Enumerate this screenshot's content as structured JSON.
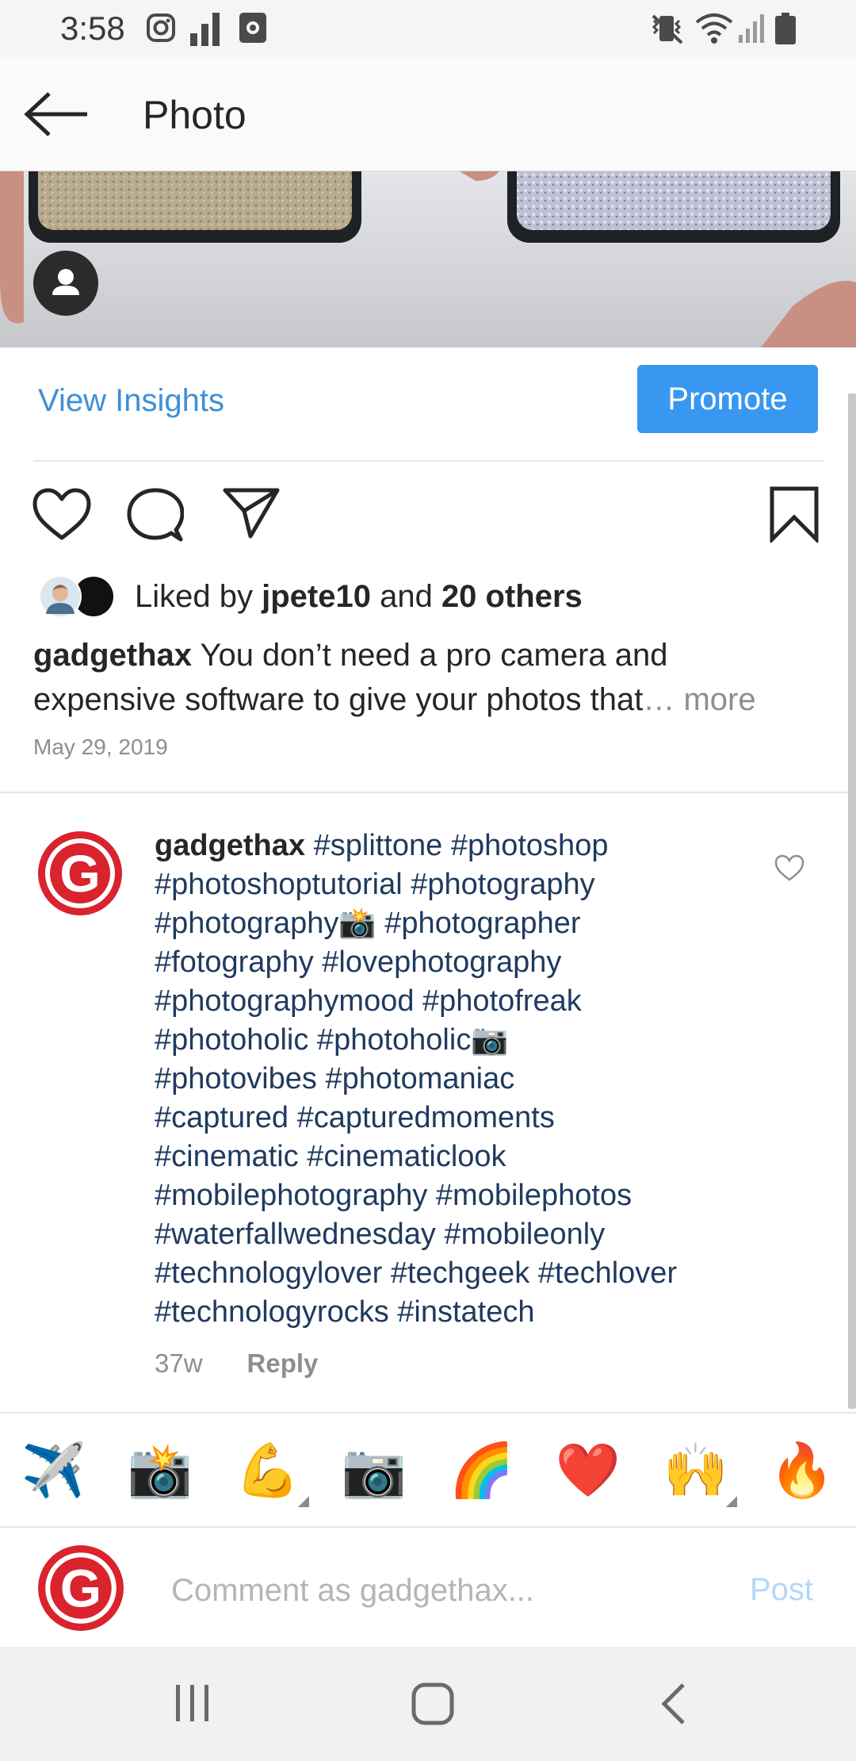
{
  "status_bar": {
    "time": "3:58"
  },
  "header": {
    "title": "Photo"
  },
  "insights": {
    "link_label": "View Insights",
    "promote_label": "Promote"
  },
  "likes": {
    "prefix": "Liked by ",
    "user": "jpete10",
    "middle": " and ",
    "others": "20 others"
  },
  "caption": {
    "username": "gadgethax",
    "text": " You don’t need a pro camera and expensive software to give your photos that",
    "more": "… more",
    "date": "May 29, 2019"
  },
  "comment": {
    "username": "gadgethax",
    "hashtag_lines": [
      " #splittone #photoshop",
      "#photoshoptutorial #photography",
      "#photography📸 #photographer",
      "#fotography #lovephotography",
      "#photographymood #photofreak",
      "#photoholic #photoholic📷",
      "#photovibes #photomaniac",
      "#captured #capturedmoments",
      "#cinematic #cinematiclook",
      "#mobilephotography #mobilephotos",
      "#waterfallwednesday #mobileonly",
      "#technologylover #techgeek #techlover",
      "#technologyrocks #instatech"
    ],
    "age": "37w",
    "reply_label": "Reply",
    "avatar_letter": "G"
  },
  "emoji_bar": [
    "✈️",
    "📸",
    "💪",
    "📷",
    "🌈",
    "❤️",
    "🙌",
    "🔥"
  ],
  "composer": {
    "avatar_letter": "G",
    "placeholder": "Comment as gadgethax...",
    "post_label": "Post"
  },
  "colors": {
    "accent_blue": "#3897f0",
    "link_blue": "#3f8fd6",
    "hashtag_navy": "#1f3a5f",
    "brand_red": "#d9232d"
  }
}
